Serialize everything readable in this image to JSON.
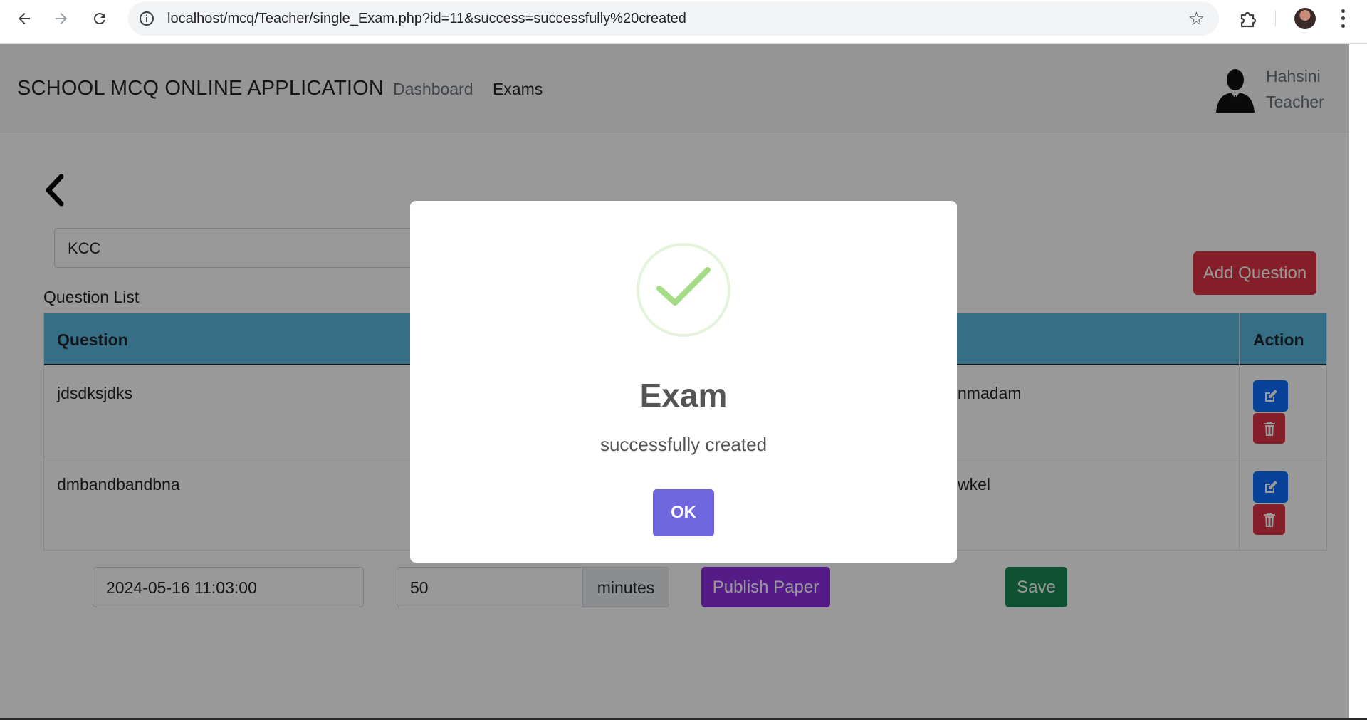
{
  "browser": {
    "url": "localhost/mcq/Teacher/single_Exam.php?id=11&success=successfully%20created"
  },
  "app": {
    "brand": "SCHOOL MCQ ONLINE APPLICATION",
    "nav": [
      {
        "label": "Dashboard"
      },
      {
        "label": "Exams"
      }
    ],
    "user": {
      "name": "Hahsini",
      "role": "Teacher"
    }
  },
  "exam": {
    "name": "KCC",
    "add_question_label": "Add Question",
    "question_list_label": "Question List",
    "table": {
      "headers": {
        "question": "Question",
        "action": "Action"
      },
      "rows": [
        {
          "question": "jdsdksjdks",
          "answer_fragment": "nmadam"
        },
        {
          "question": "dmbandbandbna",
          "answer_fragment": "wkel"
        }
      ]
    },
    "start_datetime": "2024-05-16 11:03:00",
    "duration": "50",
    "duration_unit": "minutes",
    "publish_label": "Publish Paper",
    "save_label": "Save"
  },
  "modal": {
    "title": "Exam",
    "message": "successfully created",
    "ok_label": "OK"
  },
  "colors": {
    "primary": "#0d6efd",
    "danger": "#dc3545",
    "success": "#198754",
    "publish": "#8e2de2",
    "table_header": "#5bb8e0",
    "modal_confirm": "#7066e0",
    "success_check": "#a5dc86"
  },
  "icons": {
    "back": "arrow-left-icon",
    "forward": "arrow-right-icon",
    "reload": "reload-icon",
    "info": "info-icon",
    "bookmark": "star-icon",
    "extensions": "puzzle-icon",
    "menu": "more-vertical-icon",
    "page_back": "chevron-left-icon",
    "edit": "edit-icon",
    "delete": "trash-icon",
    "success": "checkmark-icon",
    "user": "user-avatar-icon"
  }
}
